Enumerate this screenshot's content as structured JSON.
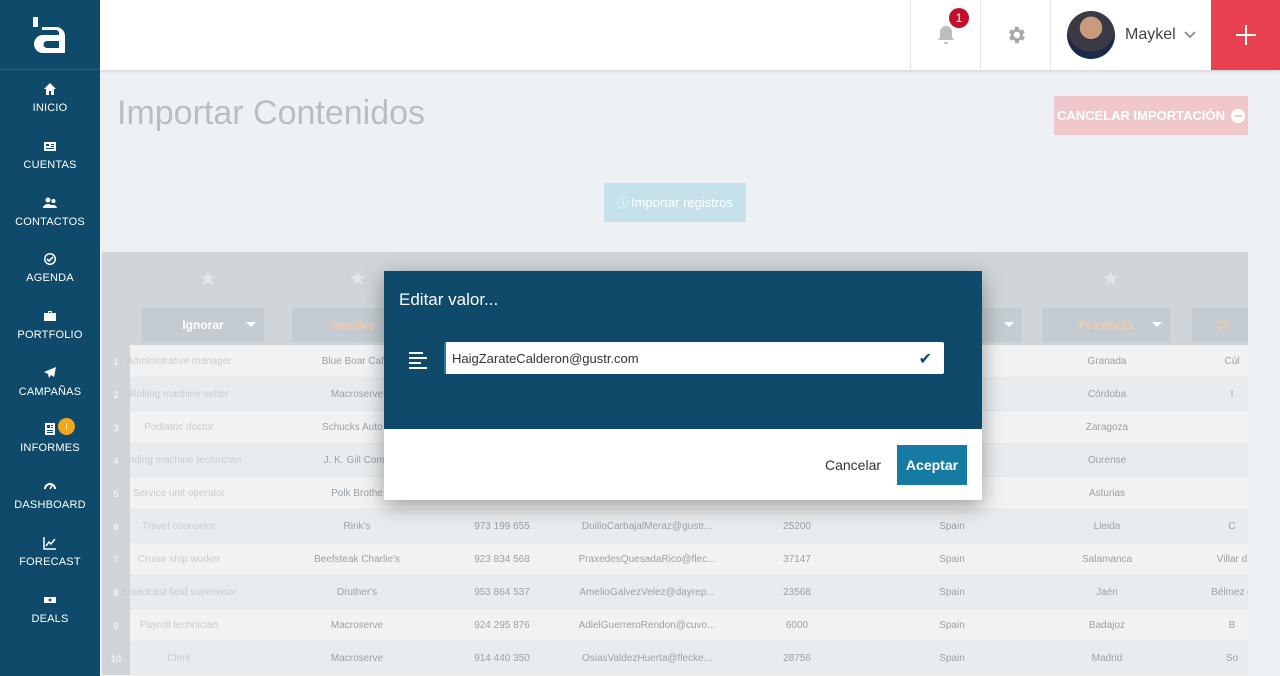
{
  "sidebar": {
    "logo": "a",
    "items": [
      {
        "label": "INICIO",
        "icon": "home-icon"
      },
      {
        "label": "CUENTAS",
        "icon": "accounts-icon"
      },
      {
        "label": "CONTACTOS",
        "icon": "contacts-icon"
      },
      {
        "label": "AGENDA",
        "icon": "check-circle-icon"
      },
      {
        "label": "PORTFOLIO",
        "icon": "briefcase-icon"
      },
      {
        "label": "CAMPAÑAS",
        "icon": "paper-plane-icon"
      },
      {
        "label": "INFORMES",
        "icon": "report-icon",
        "badge": "!"
      },
      {
        "label": "DASHBOARD",
        "icon": "gauge-icon"
      },
      {
        "label": "FORECAST",
        "icon": "line-chart-icon"
      },
      {
        "label": "DEALS",
        "icon": "money-icon"
      }
    ]
  },
  "topbar": {
    "notifications_count": "1",
    "user_name": "Maykel"
  },
  "page": {
    "title": "Importar Contenidos",
    "cancel_import_label": "CANCELAR IMPORTACIÓN",
    "import_records_label": "Importar registros"
  },
  "grid": {
    "columns": [
      "Ignorar",
      "nombre",
      "",
      "",
      "",
      "",
      "",
      "Provincia",
      "Ci"
    ],
    "rows": [
      {
        "n": "1",
        "c": [
          "Administrative manager",
          "Blue Boar Cafet",
          "",
          "",
          "",
          "",
          "Granada",
          "Cúl"
        ]
      },
      {
        "n": "2",
        "c": [
          "Rolling machine setter",
          "Macroserve",
          "",
          "",
          "",
          "",
          "Córdoba",
          "I"
        ]
      },
      {
        "n": "3",
        "c": [
          "Podiatric doctor",
          "Schucks Auto S",
          "",
          "",
          "",
          "",
          "Zaragoza",
          ""
        ]
      },
      {
        "n": "4",
        "c": [
          "Vending machine technician",
          "J. K. Gill Comp",
          "",
          "",
          "",
          "",
          "Ourense",
          ""
        ]
      },
      {
        "n": "5",
        "c": [
          "Service unit operator",
          "Polk Brothe",
          "",
          "",
          "",
          "",
          "Asturias",
          ""
        ]
      },
      {
        "n": "6",
        "c": [
          "Travel counselor",
          "Rink's",
          "973 199 655",
          "DuilioCarbajalMeraz@gustr...",
          "25200",
          "Spain",
          "Lleida",
          "C"
        ]
      },
      {
        "n": "7",
        "c": [
          "Cruise ship worker",
          "Beefsteak Charlie's",
          "923 834 568",
          "PraxedesQuesadaRico@flec...",
          "37147",
          "Spain",
          "Salamanca",
          "Villar d"
        ]
      },
      {
        "n": "8",
        "c": [
          "Broadcast field supervisor",
          "Druther's",
          "953 864 537",
          "AmelioGalvezVelez@dayrep...",
          "23568",
          "Spain",
          "Jaén",
          "Bélmez d"
        ]
      },
      {
        "n": "9",
        "c": [
          "Payroll technician",
          "Macroserve",
          "924 295 876",
          "AdielGuerreroRendon@cuvo...",
          "6000",
          "Spain",
          "Badajoz",
          "B"
        ]
      },
      {
        "n": "10",
        "c": [
          "Clerk",
          "Macroserve",
          "914 440 350",
          "OsiasValdezHuerta@flecke...",
          "28756",
          "Spain",
          "Madrid",
          "So"
        ]
      }
    ]
  },
  "dialog": {
    "title": "Editar valor...",
    "value": "HaigZarateCalderon@gustr.com",
    "cancel_label": "Cancelar",
    "accept_label": "Aceptar"
  },
  "colors": {
    "sidebar": "#0f4a6a",
    "accent_red": "#e8404f",
    "accept_button": "#157ba3"
  }
}
